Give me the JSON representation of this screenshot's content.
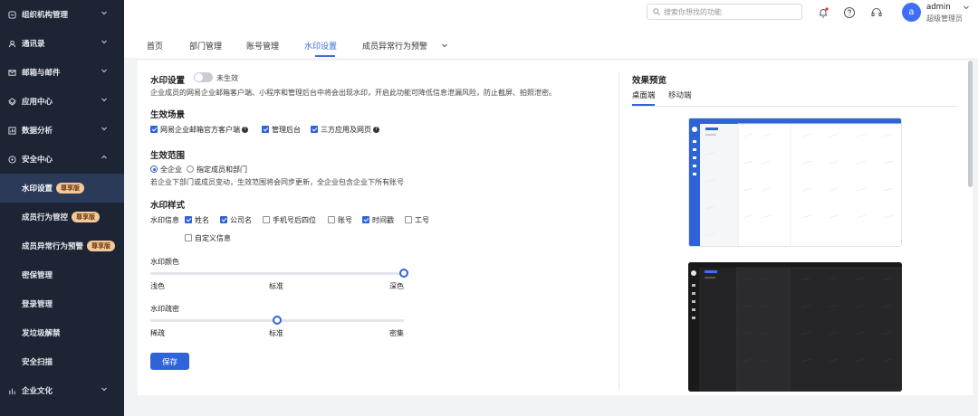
{
  "sidebar": {
    "groups": [
      {
        "label": "组织机构管理",
        "icon": "org-icon",
        "expanded": false
      },
      {
        "label": "通讯录",
        "icon": "contacts-icon",
        "expanded": false
      },
      {
        "label": "邮箱与邮件",
        "icon": "mail-icon",
        "expanded": false
      },
      {
        "label": "应用中心",
        "icon": "app-icon",
        "expanded": false
      },
      {
        "label": "数据分析",
        "icon": "chart-icon",
        "expanded": false
      },
      {
        "label": "安全中心",
        "icon": "shield-icon",
        "expanded": true
      }
    ],
    "security_items": [
      {
        "label": "水印设置",
        "badge": "尊享版",
        "active": true
      },
      {
        "label": "成员行为管控",
        "badge": "尊享版"
      },
      {
        "label": "成员异常行为预警",
        "badge": "尊享版"
      },
      {
        "label": "密保管理",
        "badge": ""
      },
      {
        "label": "登录管理",
        "badge": ""
      },
      {
        "label": "发垃圾解禁",
        "badge": ""
      },
      {
        "label": "安全扫描",
        "badge": ""
      }
    ],
    "last_group": {
      "label": "企业文化",
      "icon": "culture-icon"
    }
  },
  "topbar": {
    "search_placeholder": "搜索你想找的功能",
    "avatar_letter": "a",
    "username": "admin",
    "role": "超级管理员"
  },
  "tabs": [
    "首页",
    "部门管理",
    "账号管理",
    "水印设置",
    "成员异常行为预警"
  ],
  "active_tab": "水印设置",
  "settings": {
    "title": "水印设置",
    "status": "未生效",
    "enabled": false,
    "description": "企业成员的网易企业邮箱客户端、小程序和管理后台中将会出现水印，开启此功能可降低信息泄漏风险，防止截屏、拍照泄密。",
    "scene_title": "生效场景",
    "scenes": [
      {
        "label": "网易企业邮箱官方客户端",
        "checked": true,
        "help": true
      },
      {
        "label": "管理后台",
        "checked": true,
        "help": false
      },
      {
        "label": "三方应用及网页",
        "checked": true,
        "help": true
      }
    ],
    "range_title": "生效范围",
    "ranges": [
      {
        "label": "全企业",
        "selected": true
      },
      {
        "label": "指定成员和部门",
        "selected": false
      }
    ],
    "range_note": "若企业下部门或成员变动，生效范围将会同步更新，全企业包含企业下所有账号",
    "style_title": "水印样式",
    "info_label": "水印信息",
    "info_options": [
      {
        "label": "姓名",
        "checked": true
      },
      {
        "label": "公司名",
        "checked": true
      },
      {
        "label": "手机号后四位",
        "checked": false
      },
      {
        "label": "账号",
        "checked": false
      },
      {
        "label": "时间戳",
        "checked": true
      },
      {
        "label": "工号",
        "checked": false
      },
      {
        "label": "自定义信息",
        "checked": false
      }
    ],
    "color_label": "水印颜色",
    "color_ticks": [
      "浅色",
      "标准",
      "深色"
    ],
    "color_value": 1.0,
    "density_label": "水印疏密",
    "density_ticks": [
      "稀疏",
      "标准",
      "密集"
    ],
    "density_value": 0.5,
    "save_label": "保存"
  },
  "preview": {
    "title": "效果预览",
    "tabs": [
      "桌面端",
      "移动端"
    ],
    "active_tab": "桌面端"
  },
  "colors": {
    "accent": "#2f64d9",
    "sidebar_bg": "#1d2433",
    "badge_bg": "#f4c89b"
  }
}
